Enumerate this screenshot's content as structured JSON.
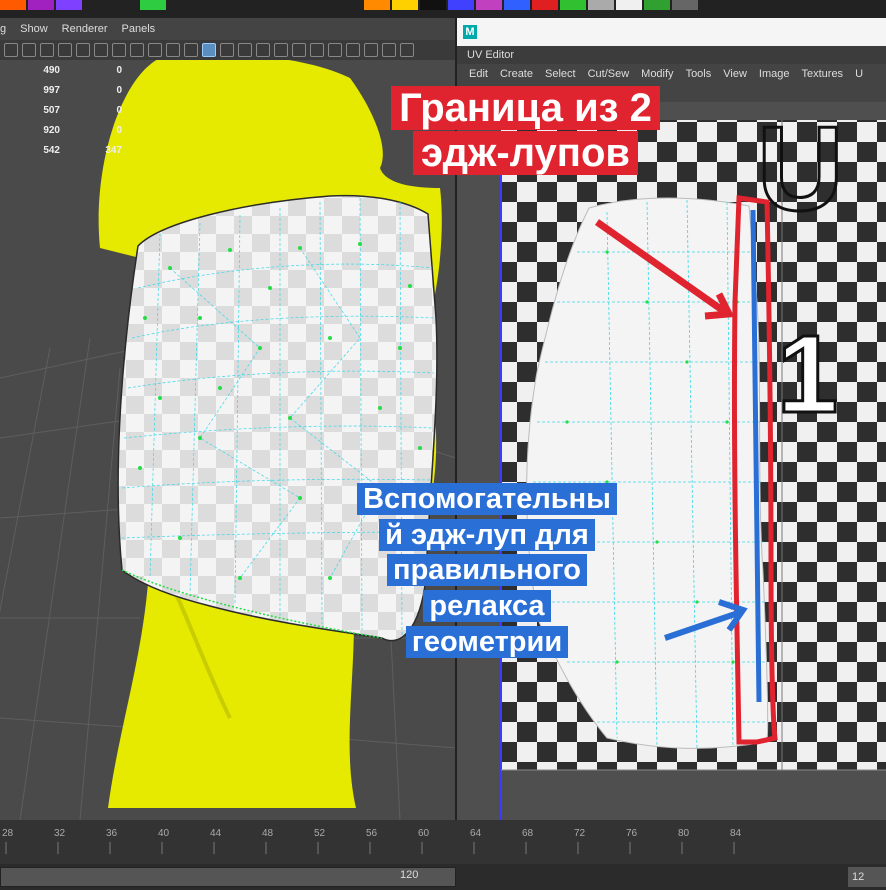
{
  "viewport": {
    "menu": [
      "g",
      "Show",
      "Renderer",
      "Panels"
    ],
    "stats": [
      {
        "a": "490",
        "b": "0"
      },
      {
        "a": "997",
        "b": "0"
      },
      {
        "a": "507",
        "b": "0"
      },
      {
        "a": "920",
        "b": "0"
      },
      {
        "a": "542",
        "b": "347"
      }
    ]
  },
  "uv_editor": {
    "app_icon": "M",
    "tab": "UV Editor",
    "menu": [
      "Edit",
      "Create",
      "Select",
      "Cut/Sew",
      "Modify",
      "Tools",
      "View",
      "Image",
      "Textures",
      "U"
    ],
    "tile_label_top": "U",
    "tile_label_bottom": "1"
  },
  "timeline": {
    "ticks": [
      "28",
      "32",
      "36",
      "40",
      "44",
      "48",
      "52",
      "56",
      "60",
      "64",
      "68",
      "72",
      "76",
      "80",
      "84"
    ],
    "range_end": "120",
    "right_value": "12"
  },
  "annotations": {
    "red": [
      "Граница из 2",
      "эдж-лупов"
    ],
    "blue": [
      "Вспомогательны",
      "й эдж-луп для",
      "правильного",
      "релакса",
      "геометрии"
    ]
  },
  "colors": {
    "model_yellow": "#e6ea00",
    "red_annotation": "#e0242f",
    "blue_annotation": "#2a6fd6",
    "wire_green": "#22dd44",
    "wire_cyan": "#3ad8e8"
  }
}
